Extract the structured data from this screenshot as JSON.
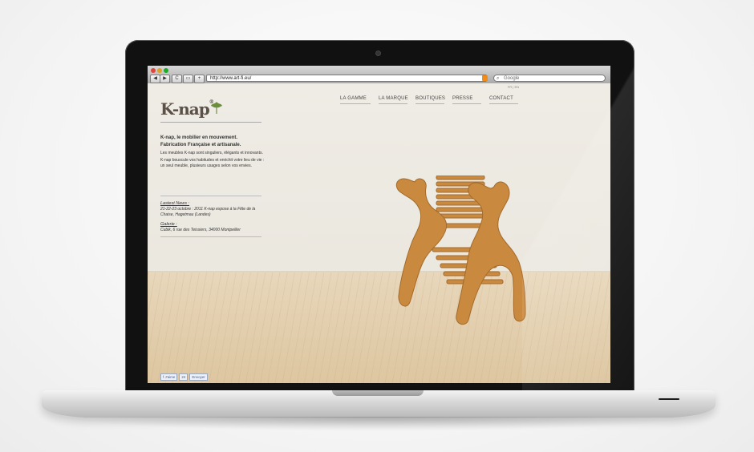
{
  "browser": {
    "url": "http://www.art-fi.eu/",
    "search_placeholder": "Google",
    "back_icon": "◀",
    "forward_icon": "▶",
    "reload_icon": "C",
    "add_icon": "+"
  },
  "site": {
    "lang": "FR | EN",
    "logo_text": "K-nap",
    "logo_mark": "®",
    "nav": [
      "LA GAMME",
      "LA MARQUE",
      "BOUTIQUES",
      "PRESSE",
      "CONTACT"
    ],
    "intro_title_1": "K-nap, le mobilier en mouvement.",
    "intro_title_2": "Fabrication Française et artisanale.",
    "intro_text_1": "Les meubles K-nap sont singuliers, élégants et innovants.",
    "intro_text_2": "K-nap bouscule vos habitudes et enrichit votre lieu de vie : un seul meuble, plusieurs usages selon vos envies.",
    "news_head": "Lastest News :",
    "news_text": "21-22-23 octobre : 2011 K-nap expose à la Fête de la Chaise, Hagetmau (Landes)",
    "gallery_head": "Galerie :",
    "gallery_text": "Cubik, 6 rue des Teissiers, 34000 Montpellier",
    "social": [
      "f J'aime",
      "24",
      "Envoyer"
    ]
  },
  "colors": {
    "logo": "#5b5148",
    "leaf": "#6b8e3a",
    "wood": "#c98a3f"
  }
}
